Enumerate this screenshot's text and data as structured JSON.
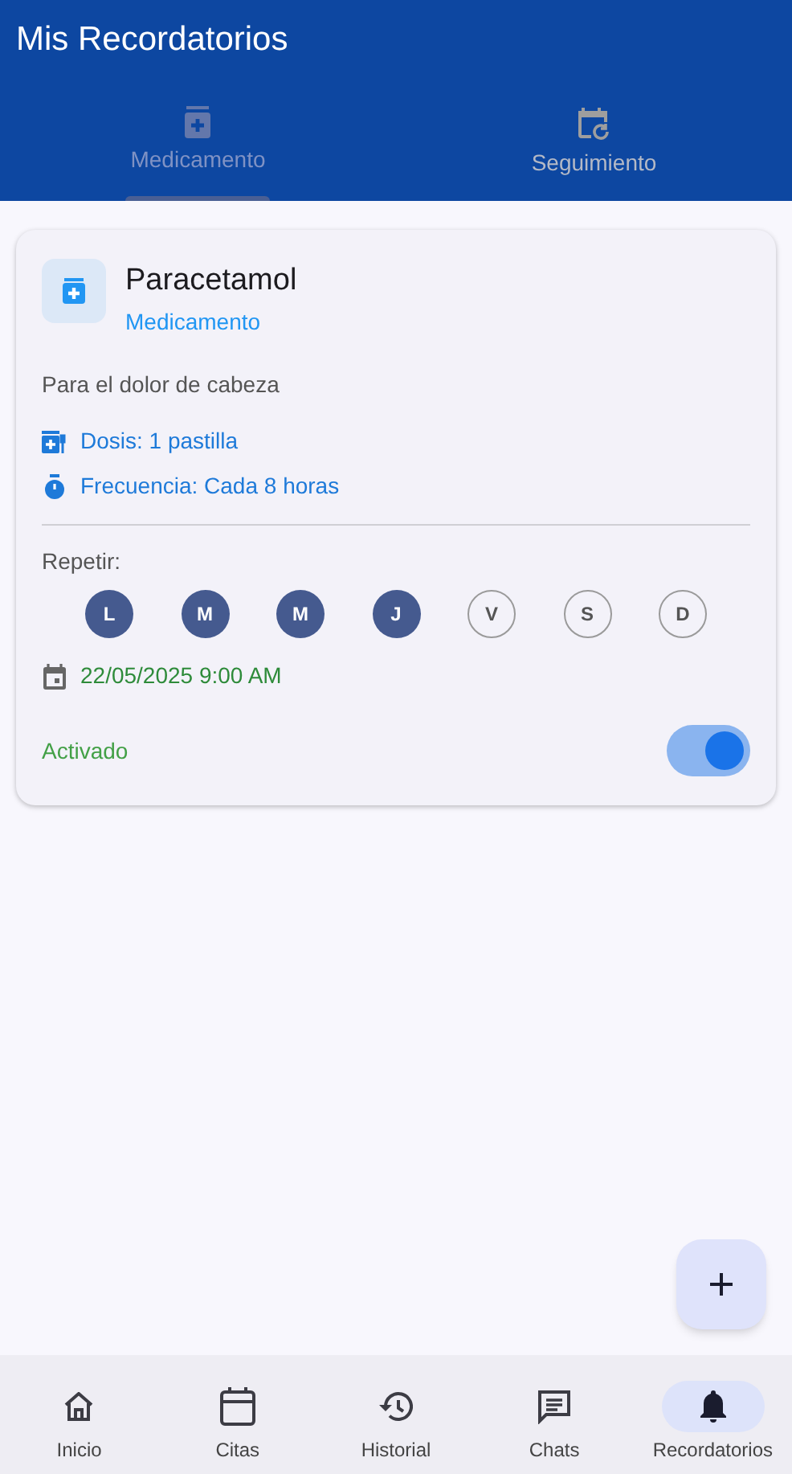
{
  "app_bar": {
    "title": "Mis Recordatorios"
  },
  "tabs": [
    {
      "label": "Medicamento",
      "selected": true
    },
    {
      "label": "Seguimiento",
      "selected": false
    }
  ],
  "reminders": [
    {
      "name": "Paracetamol",
      "type": "Medicamento",
      "description": "Para el dolor de cabeza",
      "dose": "Dosis: 1 pastilla",
      "frequency": "Frecuencia: Cada 8 horas",
      "repeat_label": "Repetir:",
      "days": [
        {
          "label": "L",
          "selected": true
        },
        {
          "label": "M",
          "selected": true
        },
        {
          "label": "M",
          "selected": true
        },
        {
          "label": "J",
          "selected": true
        },
        {
          "label": "V",
          "selected": false
        },
        {
          "label": "S",
          "selected": false
        },
        {
          "label": "D",
          "selected": false
        }
      ],
      "datetime": "22/05/2025 9:00 AM",
      "status": "Activado",
      "on": true
    }
  ],
  "bottom_nav": [
    {
      "label": "Inicio",
      "selected": false
    },
    {
      "label": "Citas",
      "selected": false
    },
    {
      "label": "Historial",
      "selected": false
    },
    {
      "label": "Chats",
      "selected": false
    },
    {
      "label": "Recordatorios",
      "selected": true
    }
  ]
}
